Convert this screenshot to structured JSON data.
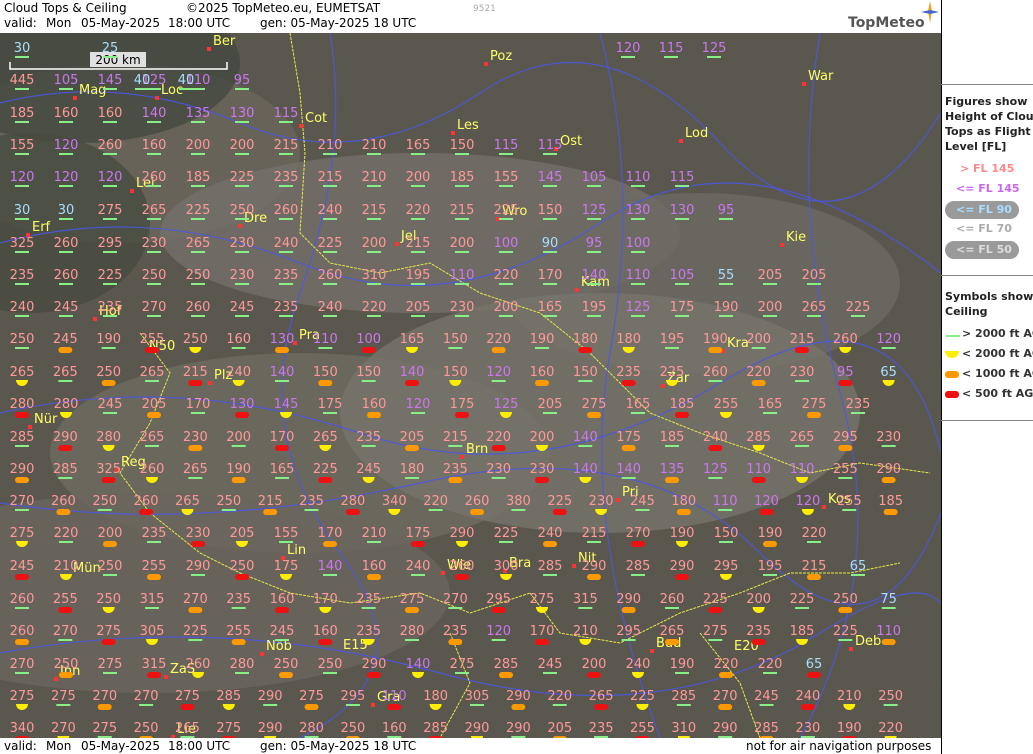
{
  "header": {
    "title": "Cloud Tops & Ceiling",
    "copyright": "©2025 TopMeteo.eu, EUMETSAT",
    "valid_label": "valid:",
    "valid_day": "Mon",
    "valid_date": "05-May-2025",
    "valid_time": "18:00 UTC",
    "gen": "gen: 05-May-2025 18 UTC",
    "id": "9521",
    "logo": "TopMeteo"
  },
  "footer": {
    "valid_label": "valid:",
    "valid_day": "Mon",
    "valid_date": "05-May-2025",
    "valid_time": "18:00 UTC",
    "gen": "gen: 05-May-2025 18 UTC",
    "disclaimer": "not for air navigation purposes"
  },
  "scale": {
    "label": "200 km"
  },
  "legend": {
    "tops_title": [
      "Figures show",
      "Height of Cloud",
      "Tops as Flight",
      "Level  [FL]"
    ],
    "tops_items": [
      {
        "text": "> FL 145",
        "color": "#ff8888"
      },
      {
        "text": "<= FL 145",
        "color": "#cc66ee"
      },
      {
        "text": "<= FL 90",
        "color": "#aaddff"
      },
      {
        "text": "<= FL 70",
        "color": "#bbbbbb"
      },
      {
        "text": "<= FL 50",
        "color": "#cccccc"
      }
    ],
    "ceil_title": [
      "Symbols show",
      "Ceiling"
    ],
    "ceil_items": [
      {
        "text": "> 2000 ft AGL",
        "symbol": "line",
        "color": "#88ee88"
      },
      {
        "text": "< 2000 ft AGL",
        "symbol": "half-disc",
        "color": "#ffee00"
      },
      {
        "text": "< 1000 ft AGL",
        "symbol": "pill",
        "color": "#ff9900"
      },
      {
        "text": "< 500 ft AGL",
        "symbol": "pill",
        "color": "#ee1111"
      }
    ]
  },
  "cities": [
    "Ber",
    "Poz",
    "War",
    "Mag",
    "Loc",
    "Cot",
    "Les",
    "Ost",
    "Lod",
    "Lei",
    "Erf",
    "Dre",
    "Wro",
    "Jel",
    "Kie",
    "Kam",
    "Hof",
    "Pra",
    "Kra",
    "N50",
    "Plz",
    "Zar",
    "Nür",
    "Brn",
    "Reg",
    "Pri",
    "Kos",
    "Lin",
    "Nit",
    "Mün",
    "Wie",
    "Bra",
    "Deb",
    "Bud",
    "E20",
    "Nöb",
    "E15",
    "Inn",
    "ZaS",
    "Gra",
    "Lie"
  ],
  "rows": [
    [
      "30",
      "25",
      "120",
      "115",
      "125"
    ],
    [
      "445",
      "105",
      "145",
      "125",
      "110",
      "95"
    ],
    [
      "40",
      "40"
    ],
    [
      "185",
      "160",
      "160",
      "140",
      "135",
      "130",
      "115"
    ],
    [
      "155",
      "120",
      "260",
      "160",
      "200",
      "200",
      "215",
      "210",
      "210",
      "165",
      "150",
      "115",
      "115"
    ],
    [
      "120",
      "120",
      "120",
      "260",
      "185",
      "225",
      "235",
      "215",
      "210",
      "200",
      "185",
      "155",
      "145",
      "105",
      "110",
      "115"
    ],
    [
      "30",
      "30",
      "275",
      "265",
      "225",
      "250",
      "260",
      "240",
      "215",
      "220",
      "215",
      "225",
      "150",
      "125",
      "130",
      "130",
      "95"
    ],
    [
      "325",
      "260",
      "295",
      "230",
      "265",
      "230",
      "240",
      "225",
      "200",
      "215",
      "200",
      "100",
      "90",
      "95",
      "100"
    ],
    [
      "235",
      "260",
      "225",
      "250",
      "250",
      "230",
      "235",
      "260",
      "310",
      "195",
      "110",
      "220",
      "170",
      "140",
      "110",
      "105",
      "55",
      "205",
      "205"
    ],
    [
      "240",
      "245",
      "235",
      "270",
      "260",
      "245",
      "235",
      "240",
      "220",
      "205",
      "230",
      "200",
      "165",
      "195",
      "125",
      "175",
      "190",
      "200",
      "265",
      "225"
    ],
    [
      "250",
      "245",
      "190",
      "255",
      "250",
      "160",
      "130",
      "110",
      "100",
      "165",
      "150",
      "220",
      "190",
      "180",
      "180",
      "195",
      "190",
      "200",
      "215",
      "260",
      "120"
    ],
    [
      "265",
      "265",
      "250",
      "265",
      "215",
      "240",
      "140",
      "150",
      "150",
      "140",
      "150",
      "120",
      "160",
      "150",
      "235",
      "225",
      "260",
      "220",
      "230",
      "95",
      "65"
    ],
    [
      "280",
      "280",
      "245",
      "205",
      "170",
      "130",
      "145",
      "175",
      "160",
      "120",
      "175",
      "125",
      "205",
      "275",
      "165",
      "185",
      "255",
      "165",
      "275",
      "235"
    ],
    [
      "285",
      "290",
      "280",
      "265",
      "230",
      "200",
      "170",
      "265",
      "235",
      "205",
      "215",
      "220",
      "200",
      "140",
      "175",
      "185",
      "240",
      "285",
      "265",
      "295",
      "230"
    ],
    [
      "290",
      "285",
      "325",
      "260",
      "265",
      "190",
      "165",
      "225",
      "245",
      "180",
      "235",
      "230",
      "230",
      "140",
      "140",
      "135",
      "125",
      "110",
      "110",
      "255",
      "290"
    ],
    [
      "270",
      "260",
      "250",
      "260",
      "265",
      "250",
      "215",
      "235",
      "280",
      "340",
      "220",
      "260",
      "380",
      "225",
      "230",
      "245",
      "180",
      "110",
      "120",
      "120",
      "255",
      "185"
    ],
    [
      "275",
      "220",
      "200",
      "235",
      "230",
      "205",
      "155",
      "170",
      "210",
      "175",
      "290",
      "225",
      "240",
      "215",
      "270",
      "190",
      "150",
      "190",
      "220"
    ],
    [
      "245",
      "210",
      "250",
      "255",
      "290",
      "250",
      "175",
      "140",
      "160",
      "240",
      "260",
      "300",
      "285",
      "290",
      "285",
      "290",
      "295",
      "195",
      "215",
      "65"
    ],
    [
      "260",
      "255",
      "250",
      "315",
      "270",
      "235",
      "160",
      "170",
      "235",
      "275",
      "270",
      "295",
      "275",
      "315",
      "290",
      "260",
      "225",
      "200",
      "225",
      "250",
      "75"
    ],
    [
      "260",
      "270",
      "275",
      "305",
      "225",
      "255",
      "245",
      "160",
      "235",
      "280",
      "235",
      "120",
      "170",
      "210",
      "295",
      "265",
      "275",
      "235",
      "185",
      "225",
      "110"
    ],
    [
      "270",
      "250",
      "275",
      "315",
      "260",
      "280",
      "250",
      "250",
      "290",
      "140",
      "275",
      "285",
      "245",
      "200",
      "240",
      "190",
      "220",
      "220",
      "65"
    ],
    [
      "275",
      "275",
      "270",
      "270",
      "275",
      "285",
      "290",
      "275",
      "295",
      "110",
      "180",
      "305",
      "290",
      "220",
      "265",
      "225",
      "285",
      "270",
      "245",
      "240",
      "210",
      "250"
    ],
    [
      "340",
      "270",
      "275",
      "250",
      "265",
      "275",
      "290",
      "280",
      "250",
      "160",
      "285",
      "290",
      "290",
      "205",
      "235",
      "255",
      "310",
      "290",
      "285",
      "230",
      "190",
      "220"
    ]
  ],
  "colors": {
    "high": "#ff9999",
    "mid": "#cc77ee",
    "low": "#aaddff",
    "city": "#ffff66",
    "river": "#4b57e6",
    "border": "#e8e84a",
    "map": "#5a574e"
  }
}
